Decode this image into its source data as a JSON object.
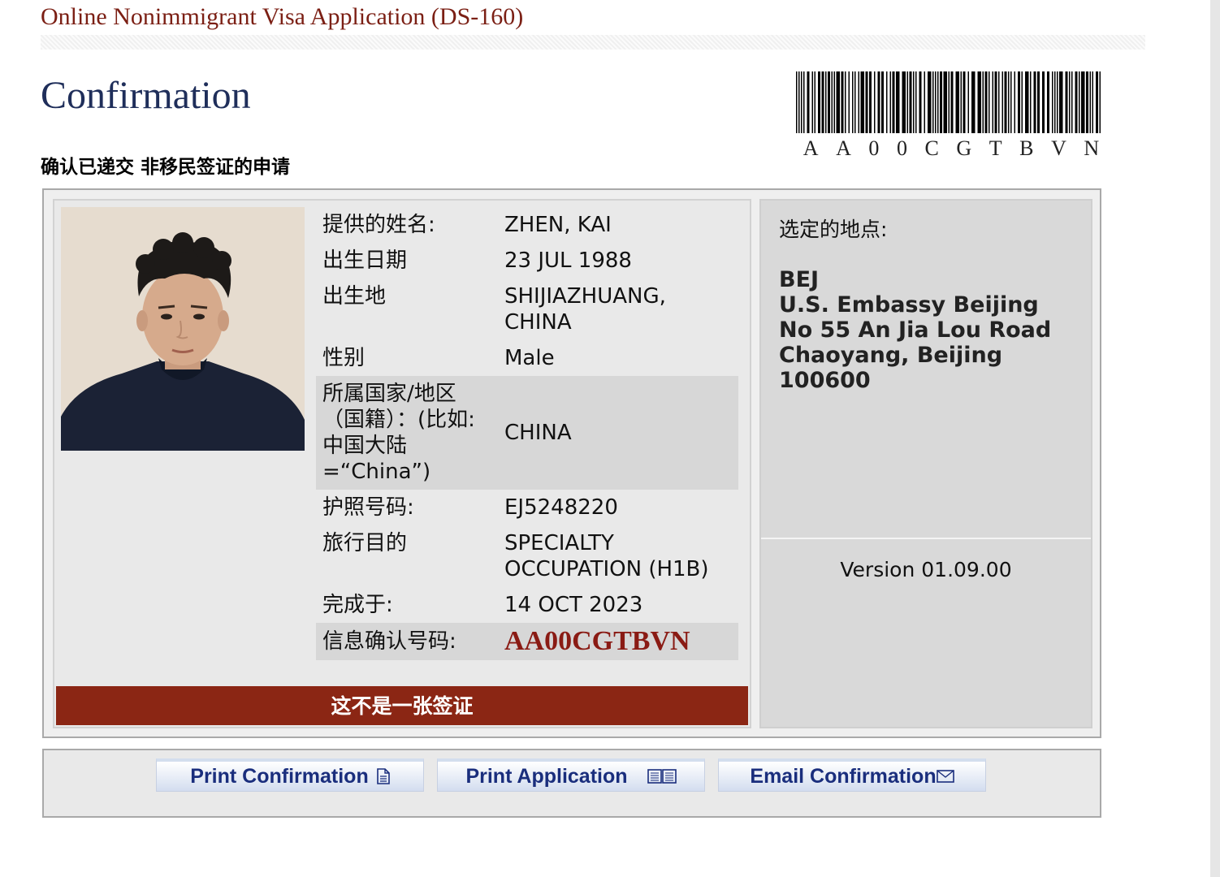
{
  "header": {
    "app_title": "Online Nonimmigrant Visa Application (DS-160)",
    "page_title": "Confirmation",
    "subtitle": "确认已递交 非移民签证的申请"
  },
  "barcode": {
    "code_chars": [
      "A",
      "A",
      "0",
      "0",
      "C",
      "G",
      "T",
      "B",
      "V",
      "N"
    ]
  },
  "applicant": {
    "photo_alt": "Applicant photo",
    "fields": [
      {
        "label": "提供的姓名:",
        "value": "ZHEN, KAI"
      },
      {
        "label": "出生日期",
        "value": "23 JUL 1988"
      },
      {
        "label": "出生地",
        "value": "SHIJIAZHUANG, CHINA"
      },
      {
        "label": "性别",
        "value": "Male"
      },
      {
        "label": "所属国家/地区（国籍）：(比如:中国大陆=“China”)",
        "value": "CHINA"
      },
      {
        "label": "护照号码:",
        "value": "EJ5248220"
      },
      {
        "label": "旅行目的",
        "value": "SPECIALTY OCCUPATION (H1B)"
      },
      {
        "label": "完成于:",
        "value": "14 OCT 2023"
      },
      {
        "label": "信息确认号码:",
        "value": "AA00CGTBVN"
      }
    ]
  },
  "banner_text": "这不是一张签证",
  "location": {
    "label": "选定的地点:",
    "code": "BEJ",
    "name": "U.S. Embassy Beijing",
    "address1": "No 55 An Jia Lou Road",
    "address2": "Chaoyang, Beijing 100600"
  },
  "version_text": "Version 01.09.00",
  "buttons": {
    "print_confirmation": "Print Confirmation",
    "print_application": "Print Application",
    "email_confirmation": "Email Confirmation"
  },
  "icons": {
    "print_confirmation": "document-icon",
    "print_application": "book-icon",
    "email_confirmation": "envelope-icon"
  },
  "colors": {
    "title_red": "#7b1f14",
    "page_title_navy": "#1f2e5a",
    "banner_red": "#8b2614",
    "button_text_blue": "#1a2e7d"
  }
}
